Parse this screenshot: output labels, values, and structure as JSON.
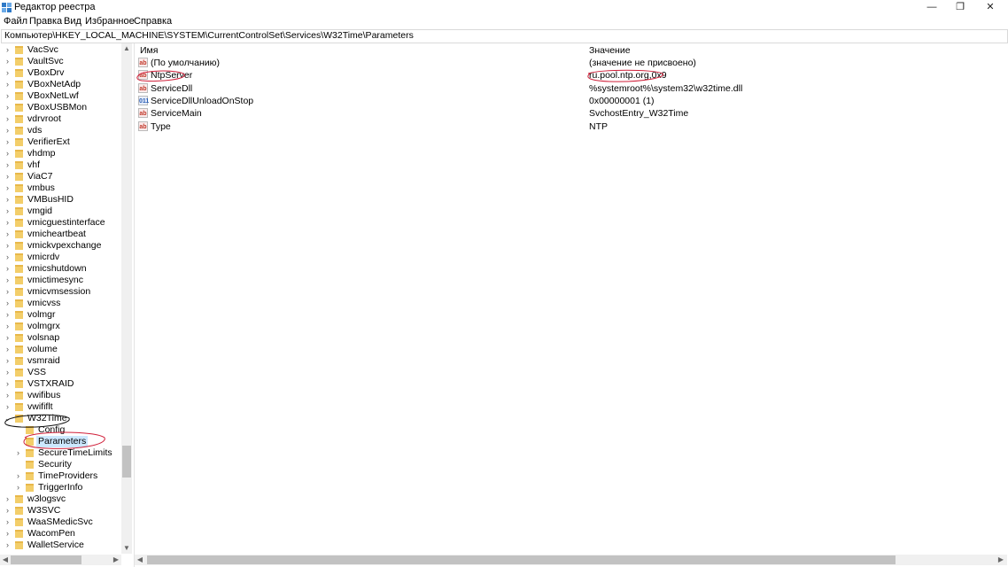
{
  "window": {
    "title": "Редактор реестра",
    "minimize": "—",
    "restore": "❐",
    "close": "✕"
  },
  "menu": [
    "Файл",
    "Правка",
    "Вид",
    "Избранное",
    "Справка"
  ],
  "address": "Компьютер\\HKEY_LOCAL_MACHINE\\SYSTEM\\CurrentControlSet\\Services\\W32Time\\Parameters",
  "tree": {
    "items": [
      {
        "label": "VacSvc",
        "expandable": true,
        "level": 0
      },
      {
        "label": "VaultSvc",
        "expandable": true,
        "level": 0
      },
      {
        "label": "VBoxDrv",
        "expandable": true,
        "level": 0
      },
      {
        "label": "VBoxNetAdp",
        "expandable": true,
        "level": 0
      },
      {
        "label": "VBoxNetLwf",
        "expandable": true,
        "level": 0
      },
      {
        "label": "VBoxUSBMon",
        "expandable": true,
        "level": 0
      },
      {
        "label": "vdrvroot",
        "expandable": true,
        "level": 0
      },
      {
        "label": "vds",
        "expandable": true,
        "level": 0
      },
      {
        "label": "VerifierExt",
        "expandable": true,
        "level": 0
      },
      {
        "label": "vhdmp",
        "expandable": true,
        "level": 0
      },
      {
        "label": "vhf",
        "expandable": true,
        "level": 0
      },
      {
        "label": "ViaC7",
        "expandable": true,
        "level": 0
      },
      {
        "label": "vmbus",
        "expandable": true,
        "level": 0
      },
      {
        "label": "VMBusHID",
        "expandable": true,
        "level": 0
      },
      {
        "label": "vmgid",
        "expandable": true,
        "level": 0
      },
      {
        "label": "vmicguestinterface",
        "expandable": true,
        "level": 0
      },
      {
        "label": "vmicheartbeat",
        "expandable": true,
        "level": 0
      },
      {
        "label": "vmickvpexchange",
        "expandable": true,
        "level": 0
      },
      {
        "label": "vmicrdv",
        "expandable": true,
        "level": 0
      },
      {
        "label": "vmicshutdown",
        "expandable": true,
        "level": 0
      },
      {
        "label": "vmictimesync",
        "expandable": true,
        "level": 0
      },
      {
        "label": "vmicvmsession",
        "expandable": true,
        "level": 0
      },
      {
        "label": "vmicvss",
        "expandable": true,
        "level": 0
      },
      {
        "label": "volmgr",
        "expandable": true,
        "level": 0
      },
      {
        "label": "volmgrx",
        "expandable": true,
        "level": 0
      },
      {
        "label": "volsnap",
        "expandable": true,
        "level": 0
      },
      {
        "label": "volume",
        "expandable": true,
        "level": 0
      },
      {
        "label": "vsmraid",
        "expandable": true,
        "level": 0
      },
      {
        "label": "VSS",
        "expandable": true,
        "level": 0
      },
      {
        "label": "VSTXRAID",
        "expandable": true,
        "level": 0
      },
      {
        "label": "vwifibus",
        "expandable": true,
        "level": 0
      },
      {
        "label": "vwififlt",
        "expandable": true,
        "level": 0
      },
      {
        "label": "W32Time",
        "expandable": true,
        "expanded": true,
        "level": 0
      },
      {
        "label": "Config",
        "expandable": false,
        "level": 1
      },
      {
        "label": "Parameters",
        "expandable": false,
        "level": 1,
        "selected": true
      },
      {
        "label": "SecureTimeLimits",
        "expandable": true,
        "level": 1
      },
      {
        "label": "Security",
        "expandable": false,
        "level": 1
      },
      {
        "label": "TimeProviders",
        "expandable": true,
        "level": 1
      },
      {
        "label": "TriggerInfo",
        "expandable": true,
        "level": 1
      },
      {
        "label": "w3logsvc",
        "expandable": true,
        "level": 0
      },
      {
        "label": "W3SVC",
        "expandable": true,
        "level": 0
      },
      {
        "label": "WaaSMedicSvc",
        "expandable": true,
        "level": 0
      },
      {
        "label": "WacomPen",
        "expandable": true,
        "level": 0
      },
      {
        "label": "WalletService",
        "expandable": true,
        "level": 0
      }
    ]
  },
  "values_pane": {
    "columns": {
      "name": "Имя",
      "data": "Значение"
    },
    "rows": [
      {
        "icon": "ab",
        "name": "(По умолчанию)",
        "data": "(значение не присвоено)",
        "kind": "sz"
      },
      {
        "icon": "ab",
        "name": "NtpServer",
        "data": "ru.pool.ntp.org,0x9",
        "kind": "sz"
      },
      {
        "icon": "ab",
        "name": "ServiceDll",
        "data": "%systemroot%\\system32\\w32time.dll",
        "kind": "sz"
      },
      {
        "icon": "011",
        "name": "ServiceDllUnloadOnStop",
        "data": "0x00000001 (1)",
        "kind": "dw"
      },
      {
        "icon": "ab",
        "name": "ServiceMain",
        "data": "SvchostEntry_W32Time",
        "kind": "sz"
      },
      {
        "icon": "ab",
        "name": "Type",
        "data": "NTP",
        "kind": "sz"
      }
    ]
  },
  "colors": {
    "annotation": "#d0203a",
    "selection": "#cce8ff",
    "folder": "#f3ce6a"
  }
}
